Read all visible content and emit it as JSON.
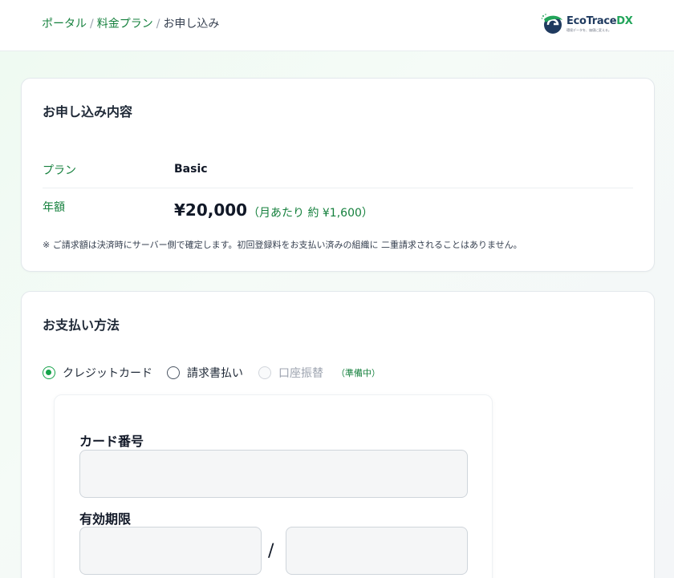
{
  "breadcrumb": {
    "items": [
      "ポータル",
      "料金プラン"
    ],
    "current": "お申し込み",
    "separator": "/"
  },
  "logo": {
    "name_main": "EcoTrace",
    "name_accent": "DX",
    "tagline": "環境データを、価値に変える。"
  },
  "summary": {
    "title": "お申し込み内容",
    "plan_label": "プラン",
    "plan_value": "Basic",
    "annual_label": "年額",
    "annual_value": "¥20,000",
    "annual_note": "（月あたり 約 ¥1,600）",
    "footnote": "※ ご請求額は決済時にサーバー側で確定します。初回登録料をお支払い済みの組織に 二重請求されることはありません。"
  },
  "payment": {
    "title": "お支払い方法",
    "methods": [
      {
        "label": "クレジットカード",
        "selected": true,
        "disabled": false
      },
      {
        "label": "請求書払い",
        "selected": false,
        "disabled": false
      },
      {
        "label": "口座振替",
        "selected": false,
        "disabled": true
      }
    ],
    "prep_note": "（準備中）",
    "card_form": {
      "card_number_label": "カード番号",
      "card_number_value": "",
      "expiry_label": "有効期限",
      "month_value": "",
      "year_value": "",
      "slash": "/"
    }
  },
  "colors": {
    "accent_green": "#16a34a",
    "link_green": "#15803d",
    "logo_navy": "#1f3a5f"
  }
}
